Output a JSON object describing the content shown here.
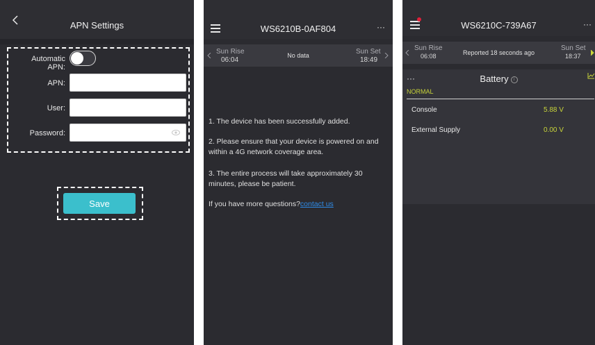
{
  "apn_settings": {
    "title": "APN Settings",
    "automatic_apn_label": "Automatic APN:",
    "automatic_apn_enabled": false,
    "apn_label": "APN:",
    "apn_value": "",
    "user_label": "User:",
    "user_value": "",
    "password_label": "Password:",
    "password_value": "",
    "save_label": "Save",
    "accent": "#3bbfcc"
  },
  "device_added": {
    "title": "WS6210B-0AF804",
    "menu_dots": "···",
    "sunrise_label": "Sun Rise",
    "sunrise_time": "06:04",
    "status": "No data",
    "sunset_label": "Sun Set",
    "sunset_time": "18:49",
    "messages": [
      "1. The device has been successfully added.",
      "2. Please ensure that your device is powered on and within a 4G network coverage area.",
      "3. The entire process will take approximately 30 minutes, please be patient."
    ],
    "questions_text": "If you have more questions?",
    "contact_link": "contact us",
    "link_color": "#2f8ce8"
  },
  "battery_view": {
    "title": "WS6210C-739A67",
    "menu_dots": "···",
    "sunrise_label": "Sun Rise",
    "sunrise_time": "06:08",
    "status": "Reported 18 seconds ago",
    "sunset_label": "Sun Set",
    "sunset_time": "18:37",
    "section_dots": "···",
    "section_title": "Battery",
    "state_label": "NORMAL",
    "rows": [
      {
        "label": "Console",
        "value": "5.88 V"
      },
      {
        "label": "External Supply",
        "value": "0.00 V"
      }
    ],
    "value_color": "#c8d43a",
    "notification_color": "#e0203a"
  }
}
